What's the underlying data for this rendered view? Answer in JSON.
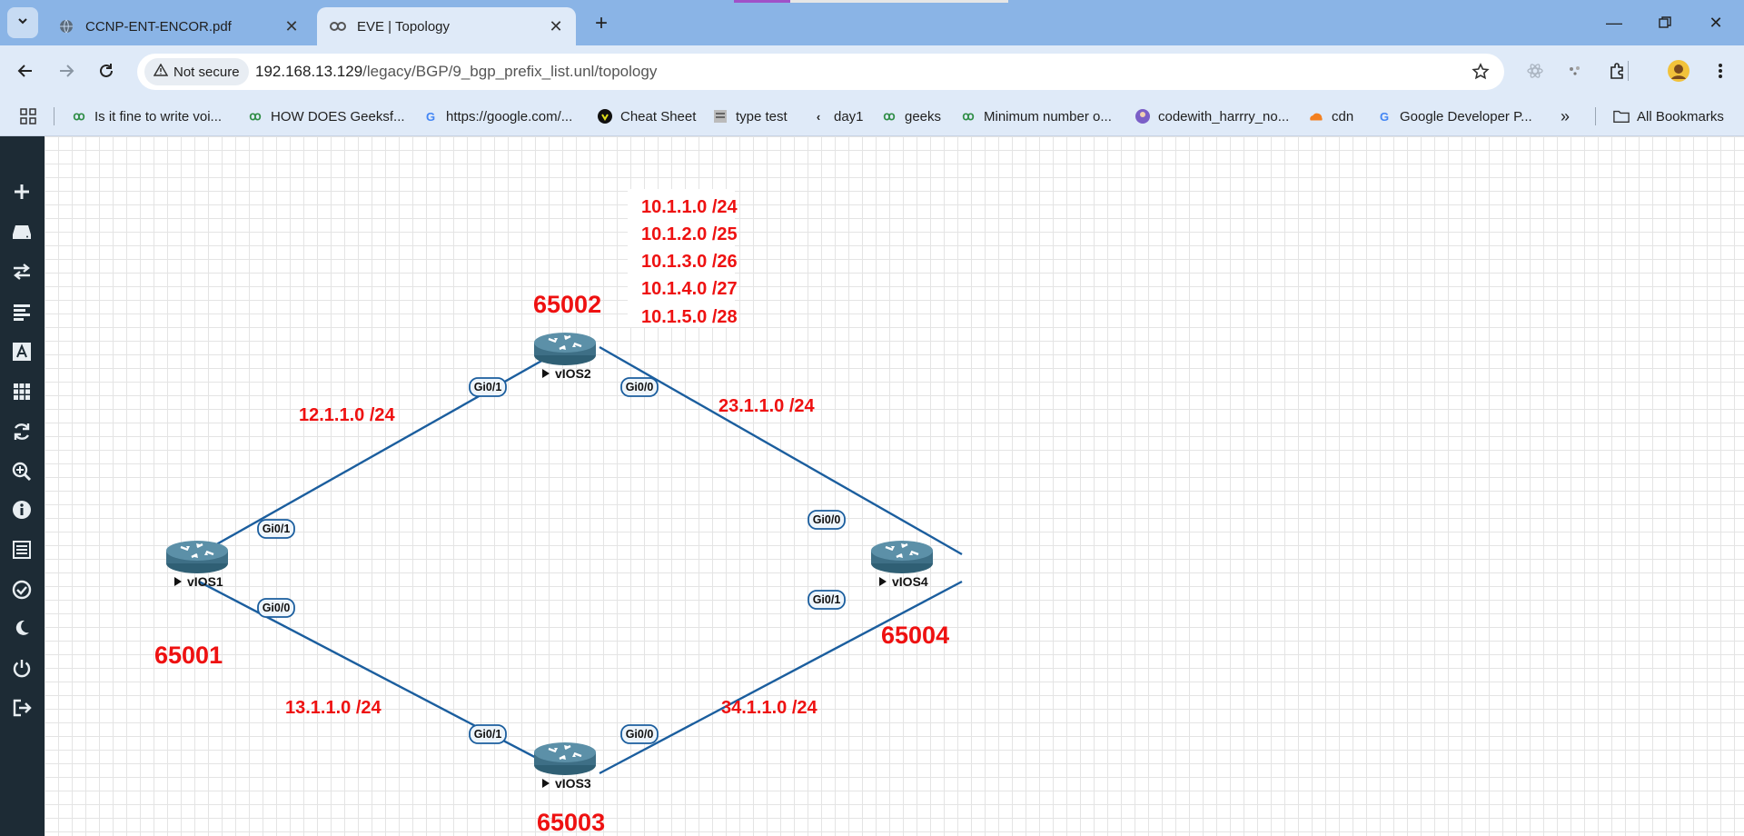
{
  "browser": {
    "tabs": [
      {
        "title": "CCNP-ENT-ENCOR.pdf",
        "icon": "globe-icon",
        "active": false
      },
      {
        "title": "EVE | Topology",
        "icon": "eve-icon",
        "active": true
      }
    ],
    "security_label": "Not secure",
    "url_host": "192.168.13.129",
    "url_path": "/legacy/BGP/9_bgp_prefix_list.unl/topology"
  },
  "bookmarks": {
    "items": [
      {
        "label": "Is it fine to write voi...",
        "icon": "geeksforgeeks-icon"
      },
      {
        "label": "HOW DOES Geeksf...",
        "icon": "geeksforgeeks-icon"
      },
      {
        "label": "https://google.com/...",
        "icon": "google-icon"
      },
      {
        "label": "Cheat Sheet",
        "icon": "cheat-sheet-icon"
      },
      {
        "label": "type test",
        "icon": "type-test-icon"
      },
      {
        "label": "day1",
        "icon": "day1-icon"
      },
      {
        "label": "geeks",
        "icon": "geeksforgeeks-icon"
      },
      {
        "label": "Minimum number o...",
        "icon": "geeksforgeeks-icon"
      },
      {
        "label": "codewith_harrry_no...",
        "icon": "avatar-icon"
      },
      {
        "label": "cdn",
        "icon": "cloudflare-icon"
      },
      {
        "label": "Google Developer P...",
        "icon": "google-icon"
      }
    ],
    "all_label": "All Bookmarks"
  },
  "topology": {
    "nodes": [
      {
        "name": "vIOS1",
        "as": "65001"
      },
      {
        "name": "vIOS2",
        "as": "65002"
      },
      {
        "name": "vIOS3",
        "as": "65003"
      },
      {
        "name": "vIOS4",
        "as": "65004"
      }
    ],
    "links": [
      {
        "subnet": "12.1.1.0 /24",
        "a_if": "Gi0/1",
        "b_if": "Gi0/1"
      },
      {
        "subnet": "23.1.1.0 /24",
        "a_if": "Gi0/0",
        "b_if": "Gi0/0"
      },
      {
        "subnet": "13.1.1.0 /24",
        "a_if": "Gi0/0",
        "b_if": "Gi0/1"
      },
      {
        "subnet": "34.1.1.0 /24",
        "a_if": "Gi0/0",
        "b_if": "Gi0/1"
      }
    ],
    "prefixes": [
      "10.1.1.0 /24",
      "10.1.2.0 /25",
      "10.1.3.0 /26",
      "10.1.4.0 /27",
      "10.1.5.0 /28"
    ],
    "colors": {
      "label": "#ee1111",
      "link": "#1b5e9e",
      "router": "#3e6f86",
      "sidebar": "#1d2b35"
    }
  },
  "sidebar": {
    "icons": [
      "add-icon",
      "nodes-icon",
      "networks-icon",
      "startup-configs-icon",
      "text-icon",
      "pictures-icon",
      "refresh-icon",
      "zoom-icon",
      "info-icon",
      "lab-list-icon",
      "status-icon",
      "dark-mode-icon",
      "power-icon",
      "logout-icon"
    ]
  }
}
